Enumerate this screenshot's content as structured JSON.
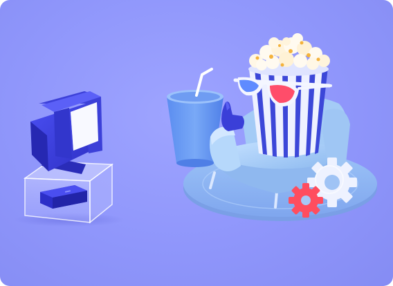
{
  "scene": {
    "description_icons": [
      "tv-icon",
      "popcorn-icon",
      "glasses-icon",
      "cup-icon",
      "armchair-icon",
      "gear-icon"
    ],
    "colors": {
      "background": "#8f96fb",
      "tv_blue": "#3b3fe0",
      "popcorn_stripe": "#3c47d8",
      "glasses_red": "#ff4d6a",
      "gear_red": "#ff4d5e",
      "gear_white": "#eef2ff",
      "chair": "#a9cff7",
      "rug": "#8fb6f2"
    }
  }
}
